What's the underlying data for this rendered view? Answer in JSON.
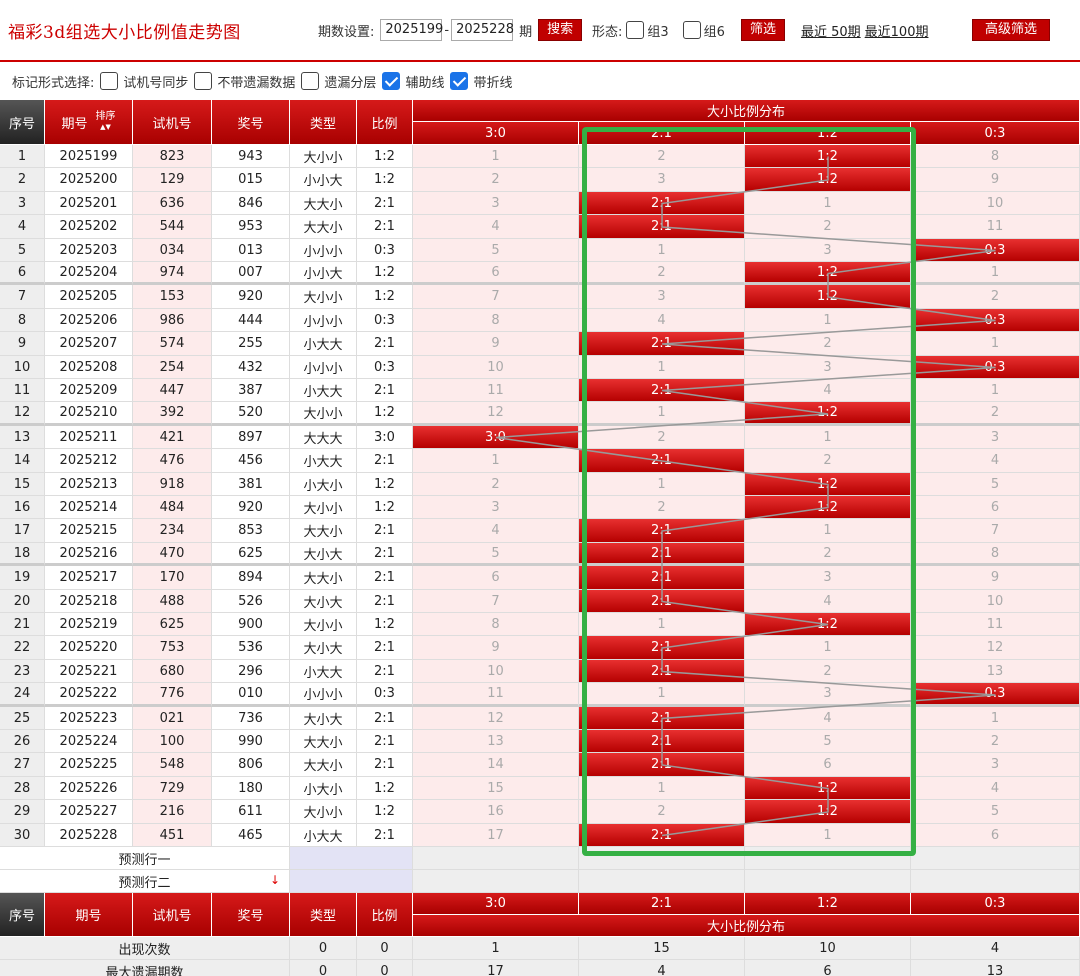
{
  "header": {
    "title": "福彩3d组选大小比例值走势图",
    "period_label": "期数设置:",
    "period_from": "2025199",
    "period_to": "2025228",
    "period_unit": "期",
    "search_label": "搜索",
    "form_label": "形态:",
    "group3_label": "组3",
    "group6_label": "组6",
    "filter_label": "筛选",
    "recent50_label": "最近 50期",
    "recent100_label": "最近100期",
    "advanced_label": "高级筛选"
  },
  "mark_bar": {
    "label": "标记形式选择:",
    "options": [
      {
        "label": "试机号同步",
        "checked": false
      },
      {
        "label": "不带遗漏数据",
        "checked": false
      },
      {
        "label": "遗漏分层",
        "checked": false
      },
      {
        "label": "辅助线",
        "checked": true
      },
      {
        "label": "带折线",
        "checked": true
      }
    ]
  },
  "table": {
    "headers": {
      "index": "序号",
      "period": "期号",
      "sort": "排序",
      "trial": "试机号",
      "number": "奖号",
      "type": "类型",
      "ratio": "比例",
      "dist": "大小比例分布"
    },
    "ratio_columns": [
      "3:0",
      "2:1",
      "1:2",
      "0:3"
    ],
    "rows": [
      {
        "idx": "1",
        "period": "2025199",
        "trial": "823",
        "number": "943",
        "type": "大小小",
        "ratio": "1:2",
        "cells": [
          "1",
          "2",
          "1:2",
          "8"
        ],
        "hit": 2
      },
      {
        "idx": "2",
        "period": "2025200",
        "trial": "129",
        "number": "015",
        "type": "小小大",
        "ratio": "1:2",
        "cells": [
          "2",
          "3",
          "1:2",
          "9"
        ],
        "hit": 2
      },
      {
        "idx": "3",
        "period": "2025201",
        "trial": "636",
        "number": "846",
        "type": "大大小",
        "ratio": "2:1",
        "cells": [
          "3",
          "2:1",
          "1",
          "10"
        ],
        "hit": 1
      },
      {
        "idx": "4",
        "period": "2025202",
        "trial": "544",
        "number": "953",
        "type": "大大小",
        "ratio": "2:1",
        "cells": [
          "4",
          "2:1",
          "2",
          "11"
        ],
        "hit": 1
      },
      {
        "idx": "5",
        "period": "2025203",
        "trial": "034",
        "number": "013",
        "type": "小小小",
        "ratio": "0:3",
        "cells": [
          "5",
          "1",
          "3",
          "0:3"
        ],
        "hit": 3
      },
      {
        "idx": "6",
        "period": "2025204",
        "trial": "974",
        "number": "007",
        "type": "小小大",
        "ratio": "1:2",
        "cells": [
          "6",
          "2",
          "1:2",
          "1"
        ],
        "hit": 2
      },
      {
        "idx": "7",
        "period": "2025205",
        "trial": "153",
        "number": "920",
        "type": "大小小",
        "ratio": "1:2",
        "cells": [
          "7",
          "3",
          "1:2",
          "2"
        ],
        "hit": 2
      },
      {
        "idx": "8",
        "period": "2025206",
        "trial": "986",
        "number": "444",
        "type": "小小小",
        "ratio": "0:3",
        "cells": [
          "8",
          "4",
          "1",
          "0:3"
        ],
        "hit": 3
      },
      {
        "idx": "9",
        "period": "2025207",
        "trial": "574",
        "number": "255",
        "type": "小大大",
        "ratio": "2:1",
        "cells": [
          "9",
          "2:1",
          "2",
          "1"
        ],
        "hit": 1
      },
      {
        "idx": "10",
        "period": "2025208",
        "trial": "254",
        "number": "432",
        "type": "小小小",
        "ratio": "0:3",
        "cells": [
          "10",
          "1",
          "3",
          "0:3"
        ],
        "hit": 3
      },
      {
        "idx": "11",
        "period": "2025209",
        "trial": "447",
        "number": "387",
        "type": "小大大",
        "ratio": "2:1",
        "cells": [
          "11",
          "2:1",
          "4",
          "1"
        ],
        "hit": 1
      },
      {
        "idx": "12",
        "period": "2025210",
        "trial": "392",
        "number": "520",
        "type": "大小小",
        "ratio": "1:2",
        "cells": [
          "12",
          "1",
          "1:2",
          "2"
        ],
        "hit": 2
      },
      {
        "idx": "13",
        "period": "2025211",
        "trial": "421",
        "number": "897",
        "type": "大大大",
        "ratio": "3:0",
        "cells": [
          "3:0",
          "2",
          "1",
          "3"
        ],
        "hit": 0
      },
      {
        "idx": "14",
        "period": "2025212",
        "trial": "476",
        "number": "456",
        "type": "小大大",
        "ratio": "2:1",
        "cells": [
          "1",
          "2:1",
          "2",
          "4"
        ],
        "hit": 1
      },
      {
        "idx": "15",
        "period": "2025213",
        "trial": "918",
        "number": "381",
        "type": "小大小",
        "ratio": "1:2",
        "cells": [
          "2",
          "1",
          "1:2",
          "5"
        ],
        "hit": 2
      },
      {
        "idx": "16",
        "period": "2025214",
        "trial": "484",
        "number": "920",
        "type": "大小小",
        "ratio": "1:2",
        "cells": [
          "3",
          "2",
          "1:2",
          "6"
        ],
        "hit": 2
      },
      {
        "idx": "17",
        "period": "2025215",
        "trial": "234",
        "number": "853",
        "type": "大大小",
        "ratio": "2:1",
        "cells": [
          "4",
          "2:1",
          "1",
          "7"
        ],
        "hit": 1
      },
      {
        "idx": "18",
        "period": "2025216",
        "trial": "470",
        "number": "625",
        "type": "大小大",
        "ratio": "2:1",
        "cells": [
          "5",
          "2:1",
          "2",
          "8"
        ],
        "hit": 1
      },
      {
        "idx": "19",
        "period": "2025217",
        "trial": "170",
        "number": "894",
        "type": "大大小",
        "ratio": "2:1",
        "cells": [
          "6",
          "2:1",
          "3",
          "9"
        ],
        "hit": 1
      },
      {
        "idx": "20",
        "period": "2025218",
        "trial": "488",
        "number": "526",
        "type": "大小大",
        "ratio": "2:1",
        "cells": [
          "7",
          "2:1",
          "4",
          "10"
        ],
        "hit": 1
      },
      {
        "idx": "21",
        "period": "2025219",
        "trial": "625",
        "number": "900",
        "type": "大小小",
        "ratio": "1:2",
        "cells": [
          "8",
          "1",
          "1:2",
          "11"
        ],
        "hit": 2
      },
      {
        "idx": "22",
        "period": "2025220",
        "trial": "753",
        "number": "536",
        "type": "大小大",
        "ratio": "2:1",
        "cells": [
          "9",
          "2:1",
          "1",
          "12"
        ],
        "hit": 1
      },
      {
        "idx": "23",
        "period": "2025221",
        "trial": "680",
        "number": "296",
        "type": "小大大",
        "ratio": "2:1",
        "cells": [
          "10",
          "2:1",
          "2",
          "13"
        ],
        "hit": 1
      },
      {
        "idx": "24",
        "period": "2025222",
        "trial": "776",
        "number": "010",
        "type": "小小小",
        "ratio": "0:3",
        "cells": [
          "11",
          "1",
          "3",
          "0:3"
        ],
        "hit": 3
      },
      {
        "idx": "25",
        "period": "2025223",
        "trial": "021",
        "number": "736",
        "type": "大小大",
        "ratio": "2:1",
        "cells": [
          "12",
          "2:1",
          "4",
          "1"
        ],
        "hit": 1
      },
      {
        "idx": "26",
        "period": "2025224",
        "trial": "100",
        "number": "990",
        "type": "大大小",
        "ratio": "2:1",
        "cells": [
          "13",
          "2:1",
          "5",
          "2"
        ],
        "hit": 1
      },
      {
        "idx": "27",
        "period": "2025225",
        "trial": "548",
        "number": "806",
        "type": "大大小",
        "ratio": "2:1",
        "cells": [
          "14",
          "2:1",
          "6",
          "3"
        ],
        "hit": 1
      },
      {
        "idx": "28",
        "period": "2025226",
        "trial": "729",
        "number": "180",
        "type": "小大小",
        "ratio": "1:2",
        "cells": [
          "15",
          "1",
          "1:2",
          "4"
        ],
        "hit": 2
      },
      {
        "idx": "29",
        "period": "2025227",
        "trial": "216",
        "number": "611",
        "type": "大小小",
        "ratio": "1:2",
        "cells": [
          "16",
          "2",
          "1:2",
          "5"
        ],
        "hit": 2
      },
      {
        "idx": "30",
        "period": "2025228",
        "trial": "451",
        "number": "465",
        "type": "小大大",
        "ratio": "2:1",
        "cells": [
          "17",
          "2:1",
          "1",
          "6"
        ],
        "hit": 1
      }
    ],
    "predict_rows": [
      "预测行一",
      "预测行二"
    ],
    "stats": [
      {
        "label": "出现次数",
        "type": "0",
        "ratio": "0",
        "cells": [
          "1",
          "15",
          "10",
          "4"
        ]
      },
      {
        "label": "最大遗漏期数",
        "type": "0",
        "ratio": "0",
        "cells": [
          "17",
          "4",
          "6",
          "13"
        ]
      }
    ]
  },
  "colors": {
    "brand_red": "#c00000",
    "highlight_green": "#35b044"
  }
}
